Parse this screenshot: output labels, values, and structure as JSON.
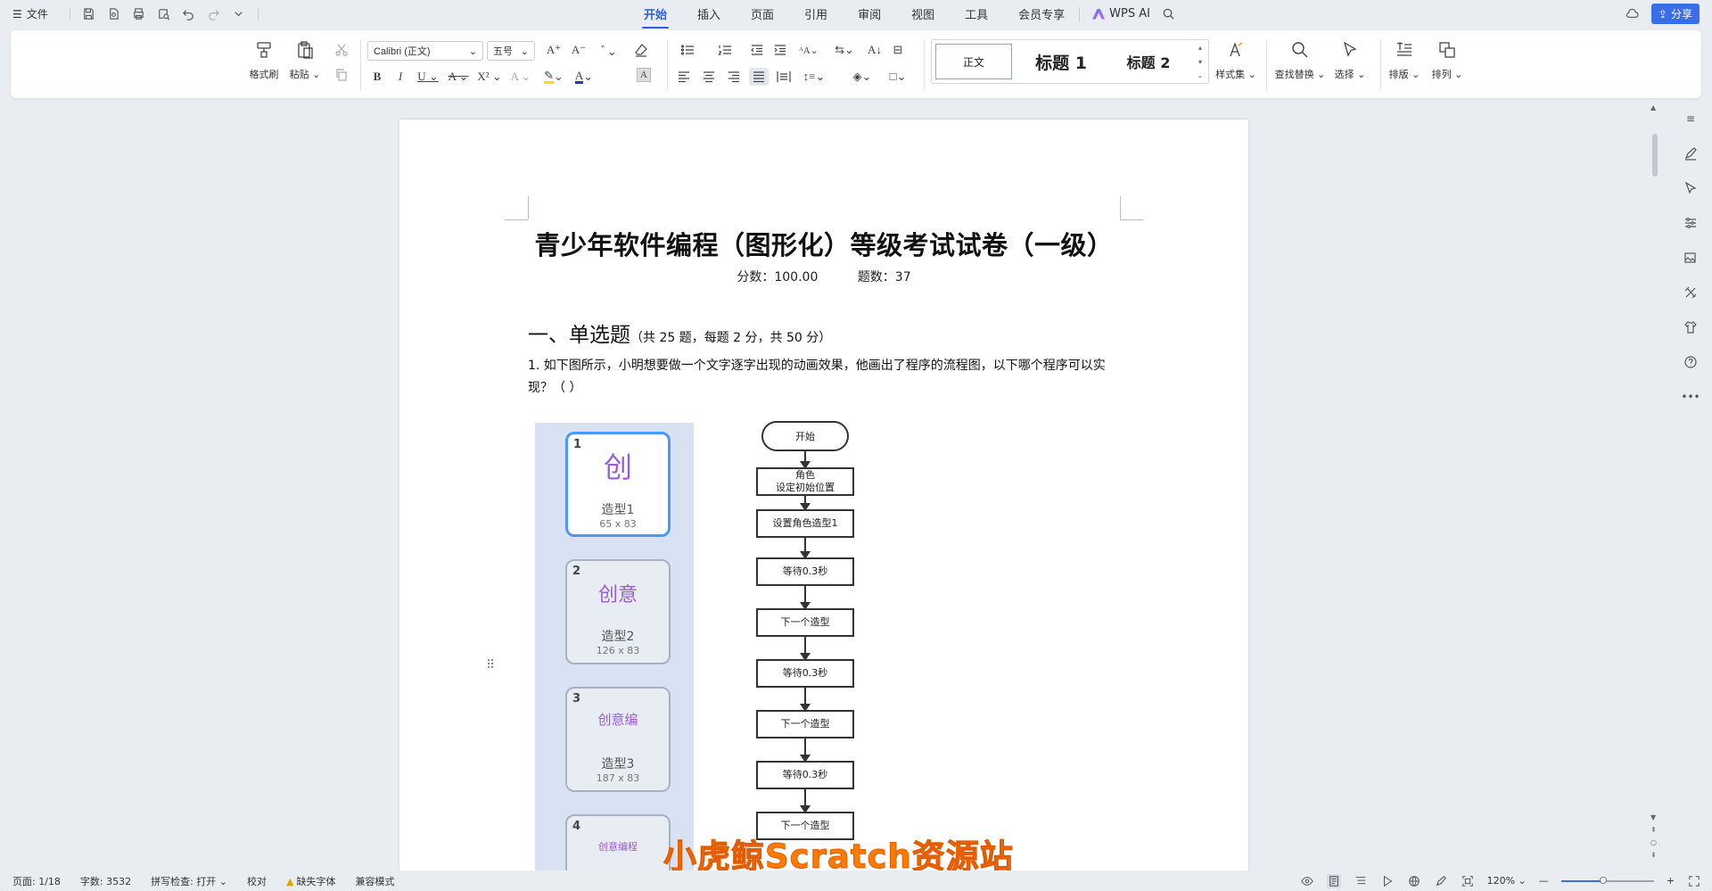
{
  "menubar": {
    "file_label": "文件",
    "tabs": [
      "开始",
      "插入",
      "页面",
      "引用",
      "审阅",
      "视图",
      "工具",
      "会员专享"
    ],
    "active_tab": "开始",
    "wps_ai_label": "WPS AI",
    "share_label": "分享"
  },
  "ribbon": {
    "format_painter": "格式刷",
    "paste": "粘贴",
    "font_name": "Calibri (正文)",
    "font_size": "五号",
    "styles": [
      "正文",
      "标题 1",
      "标题 2"
    ],
    "style_set": "样式集",
    "find_replace": "查找替换",
    "select": "选择",
    "layout": "排版",
    "arrange": "排列"
  },
  "document": {
    "title": "青少年软件编程（图形化）等级考试试卷（一级）",
    "score": "分数：100.00",
    "count": "题数：37",
    "section_heading": "一、单选题",
    "section_note": "（共 25 题，每题 2 分，共 50 分）",
    "question_1": "1. 如下图所示，小明想要做一个文字逐字出现的动画效果，他画出了程序的流程图，以下哪个程序可以实现？（ ）",
    "sprites": [
      {
        "num": "1",
        "glyph": "创",
        "name": "造型1",
        "size": "65 x 83"
      },
      {
        "num": "2",
        "glyph": "创意",
        "name": "造型2",
        "size": "126 x 83"
      },
      {
        "num": "3",
        "glyph": "创意编",
        "name": "造型3",
        "size": "187 x 83"
      },
      {
        "num": "4",
        "glyph": "创意编程",
        "name": "",
        "size": ""
      }
    ],
    "flow": {
      "start": "开始",
      "steps": [
        "角色\n设定初始位置",
        "设置角色造型1",
        "等待0.3秒",
        "下一个造型",
        "等待0.3秒",
        "下一个造型",
        "等待0.3秒",
        "下一个造型"
      ]
    },
    "watermark": "小虎鲸Scratch资源站"
  },
  "statusbar": {
    "page": "页面: 1/18",
    "words": "字数: 3532",
    "spell": "拼写检查: 打开",
    "proof": "校对",
    "missing_font": "缺失字体",
    "compat": "兼容模式",
    "zoom": "120%",
    "zoom_level": 0.45
  }
}
